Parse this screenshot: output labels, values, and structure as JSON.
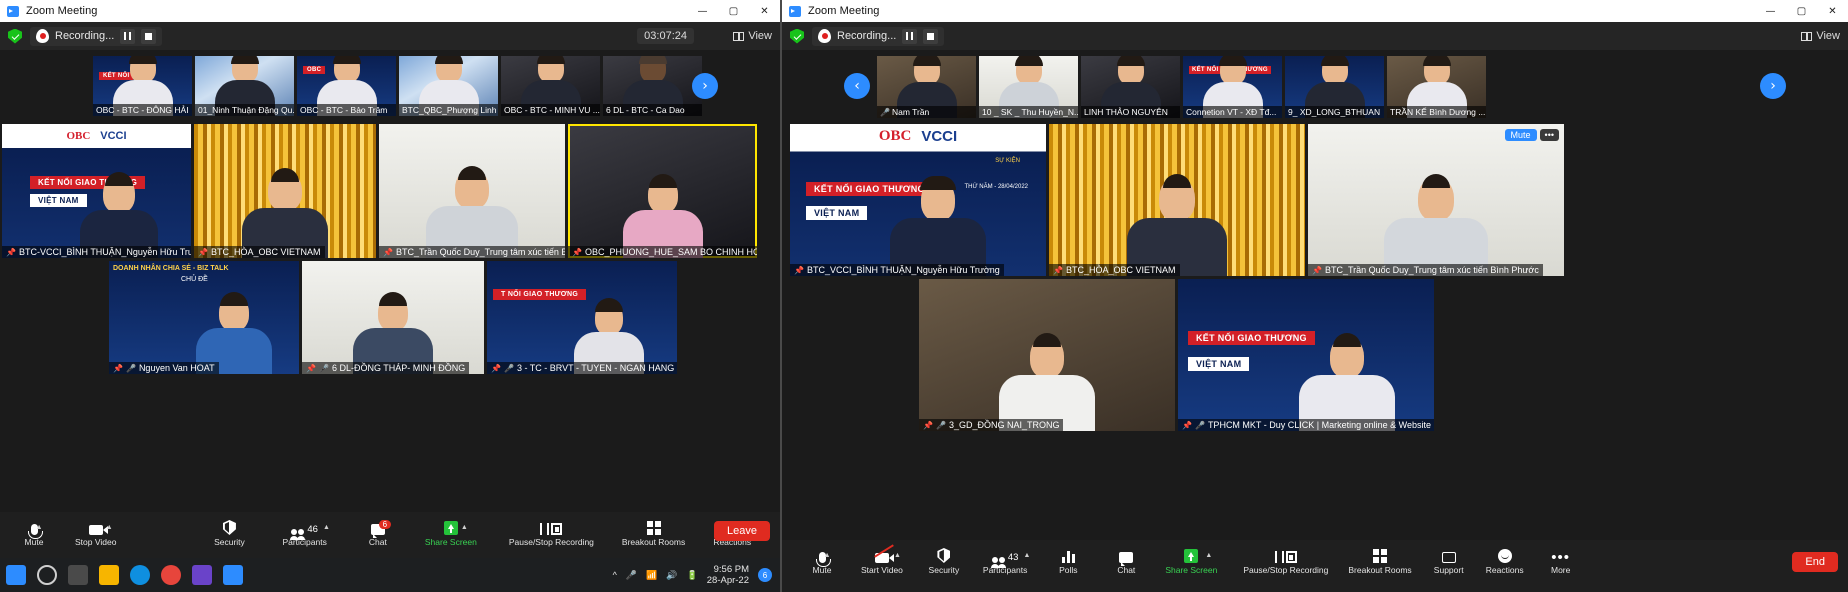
{
  "left_window": {
    "title": "Zoom Meeting",
    "window_controls": {
      "minimize": "—",
      "maximize": "▢",
      "close": "✕"
    },
    "recording": {
      "label": "Recording...",
      "pause_tooltip": "Pause Recording",
      "stop_tooltip": "Stop Recording"
    },
    "timer": "03:07:24",
    "view_button": "View",
    "filmstrip": {
      "next_arrow": "›",
      "thumbs": [
        {
          "name": "OBC - BTC - ĐÔNG HẢI",
          "bg": "bg-redbanner"
        },
        {
          "name": "01_Ninh Thuận Đặng Qu...",
          "bg": "bg-blue"
        },
        {
          "name": "OBC - BTC - Bảo Trâm",
          "bg": "bg-redbanner"
        },
        {
          "name": "BTC_QBC_Phượng Linh",
          "bg": "bg-blue"
        },
        {
          "name": "OBC - BTC - MINH VU ...",
          "bg": "bg-dark"
        },
        {
          "name": "6 DL - BTC - Ca Dao",
          "bg": "bg-dark"
        }
      ]
    },
    "tiles_row1": [
      {
        "name": "BTC-VCCI_BÌNH THUẬN_Nguyễn Hữu Trường",
        "bg": "bg-banner",
        "active": false,
        "ribbon": "KẾT NỐI GIAO THƯƠNG",
        "sub": "VIỆT NAM"
      },
      {
        "name": "BTC_HÒA_OBC VIETNAM",
        "bg": "bg-gold",
        "active": false
      },
      {
        "name": "BTC_Trần Quốc Duy_Trung tâm xúc tiến Bình Ph...",
        "bg": "bg-white",
        "active": false
      },
      {
        "name": "OBC_PHUONG_HUE_SAM BO CHINH HOANG GIA",
        "bg": "bg-dark",
        "active": true
      }
    ],
    "tiles_row2": [
      {
        "name": "Nguyen Van HOAT",
        "bg": "bg-redbanner",
        "talk": "DOANH NHÂN CHIA SẺ - BIZ TALK",
        "topic": "CHỦ ĐỀ"
      },
      {
        "name": "6 DL-ĐỒNG THÁP- MINH ĐỒNG",
        "bg": "bg-white"
      },
      {
        "name": "3 - TC - BRVT - TUYEN - NGAN HANG",
        "bg": "bg-redbanner"
      }
    ],
    "toolbar": [
      {
        "label": "Mute",
        "icon": "microphone-icon",
        "caret": true
      },
      {
        "label": "Stop Video",
        "icon": "camera-icon",
        "caret": true
      },
      {
        "label": "Security",
        "icon": "shield-icon",
        "caret": false
      },
      {
        "label": "Participants",
        "icon": "people-icon",
        "count": "46",
        "caret": true
      },
      {
        "label": "Chat",
        "icon": "chat-icon",
        "badge": "6",
        "caret": false
      },
      {
        "label": "Share Screen",
        "icon": "share-screen-icon",
        "caret": true,
        "green": true
      },
      {
        "label": "Pause/Stop Recording",
        "icon": "record-controls-icon",
        "caret": false
      },
      {
        "label": "Breakout Rooms",
        "icon": "grid-icon",
        "caret": false
      },
      {
        "label": "Reactions",
        "icon": "smiley-icon",
        "caret": false
      }
    ],
    "leave_button": "Leave"
  },
  "right_window": {
    "title": "Zoom Meeting",
    "window_controls": {
      "minimize": "—",
      "maximize": "▢",
      "close": "✕"
    },
    "recording": {
      "label": "Recording...",
      "pause_tooltip": "Pause Recording",
      "stop_tooltip": "Stop Recording"
    },
    "view_button": "View",
    "filmstrip": {
      "prev_arrow": "‹",
      "next_arrow": "›",
      "thumbs": [
        {
          "name": "Nam Trần",
          "bg": "bg-room"
        },
        {
          "name": "10 _ SK _ Thu Huyền_N...",
          "bg": "bg-white"
        },
        {
          "name": "LINH THẢO NGUYÊN",
          "bg": "bg-dark"
        },
        {
          "name": "Connetion VT - XĐ Tđ...",
          "bg": "bg-redbanner"
        },
        {
          "name": "9_ XD_LONG_BTHUAN",
          "bg": "bg-redbanner"
        },
        {
          "name": "TRẦN KẾ Bình Dương ...",
          "bg": "bg-room"
        }
      ]
    },
    "tiles_row1": [
      {
        "name": "BTC_VCCI_BÌNH THUẬN_Nguyễn Hữu Trường",
        "bg": "bg-banner",
        "ribbon": "KẾT NỐI GIAO THƯƠNG",
        "sub": "VIỆT NAM",
        "date": "THỨ NĂM - 28/04/2022",
        "event": "SỰ KIỆN"
      },
      {
        "name": "BTC_HÒA_OBC VIETNAM",
        "bg": "bg-gold"
      },
      {
        "name": "BTC_Trần Quốc Duy_Trung tâm xúc tiến Bình Phước",
        "bg": "bg-white",
        "mute_label": "Mute",
        "more_label": "•••"
      }
    ],
    "tiles_row2": [
      {
        "name": "3_GD_ĐỒNG NAI_TRONG",
        "bg": "bg-room"
      },
      {
        "name": "TPHCM MKT - Duy CLICK | Marketing online & Website",
        "bg": "bg-redbanner",
        "ribbon": "KẾT NỐI GIAO THƯƠNG",
        "sub": "VIỆT NAM"
      }
    ],
    "toolbar": [
      {
        "label": "Mute",
        "icon": "microphone-icon",
        "caret": true
      },
      {
        "label": "Start Video",
        "icon": "camera-off-icon",
        "caret": true
      },
      {
        "label": "Security",
        "icon": "shield-icon",
        "caret": false
      },
      {
        "label": "Participants",
        "icon": "people-icon",
        "count": "43",
        "caret": true
      },
      {
        "label": "Polls",
        "icon": "polls-icon",
        "caret": false
      },
      {
        "label": "Chat",
        "icon": "chat-icon",
        "caret": false
      },
      {
        "label": "Share Screen",
        "icon": "share-screen-icon",
        "caret": true,
        "green": true
      },
      {
        "label": "Pause/Stop Recording",
        "icon": "record-controls-icon",
        "caret": false
      },
      {
        "label": "Breakout Rooms",
        "icon": "grid-icon",
        "caret": false
      },
      {
        "label": "Support",
        "icon": "support-icon",
        "caret": false
      },
      {
        "label": "Reactions",
        "icon": "smiley-icon",
        "caret": false
      },
      {
        "label": "More",
        "icon": "more-dots-icon",
        "caret": false
      }
    ],
    "end_button": "End"
  },
  "taskbar": {
    "clock_time": "9:56 PM",
    "clock_date": "28-Apr-22",
    "tray_badge": "6",
    "icons": [
      "start-icon",
      "search-icon",
      "task-view-icon",
      "file-explorer-icon",
      "edge-icon",
      "chrome-icon",
      "store-icon",
      "zoom-icon"
    ]
  },
  "colors": {
    "accent_blue": "#2d8cff",
    "leave_red": "#e02b20",
    "share_green": "#24c23a",
    "active_outline": "#ffe600"
  }
}
